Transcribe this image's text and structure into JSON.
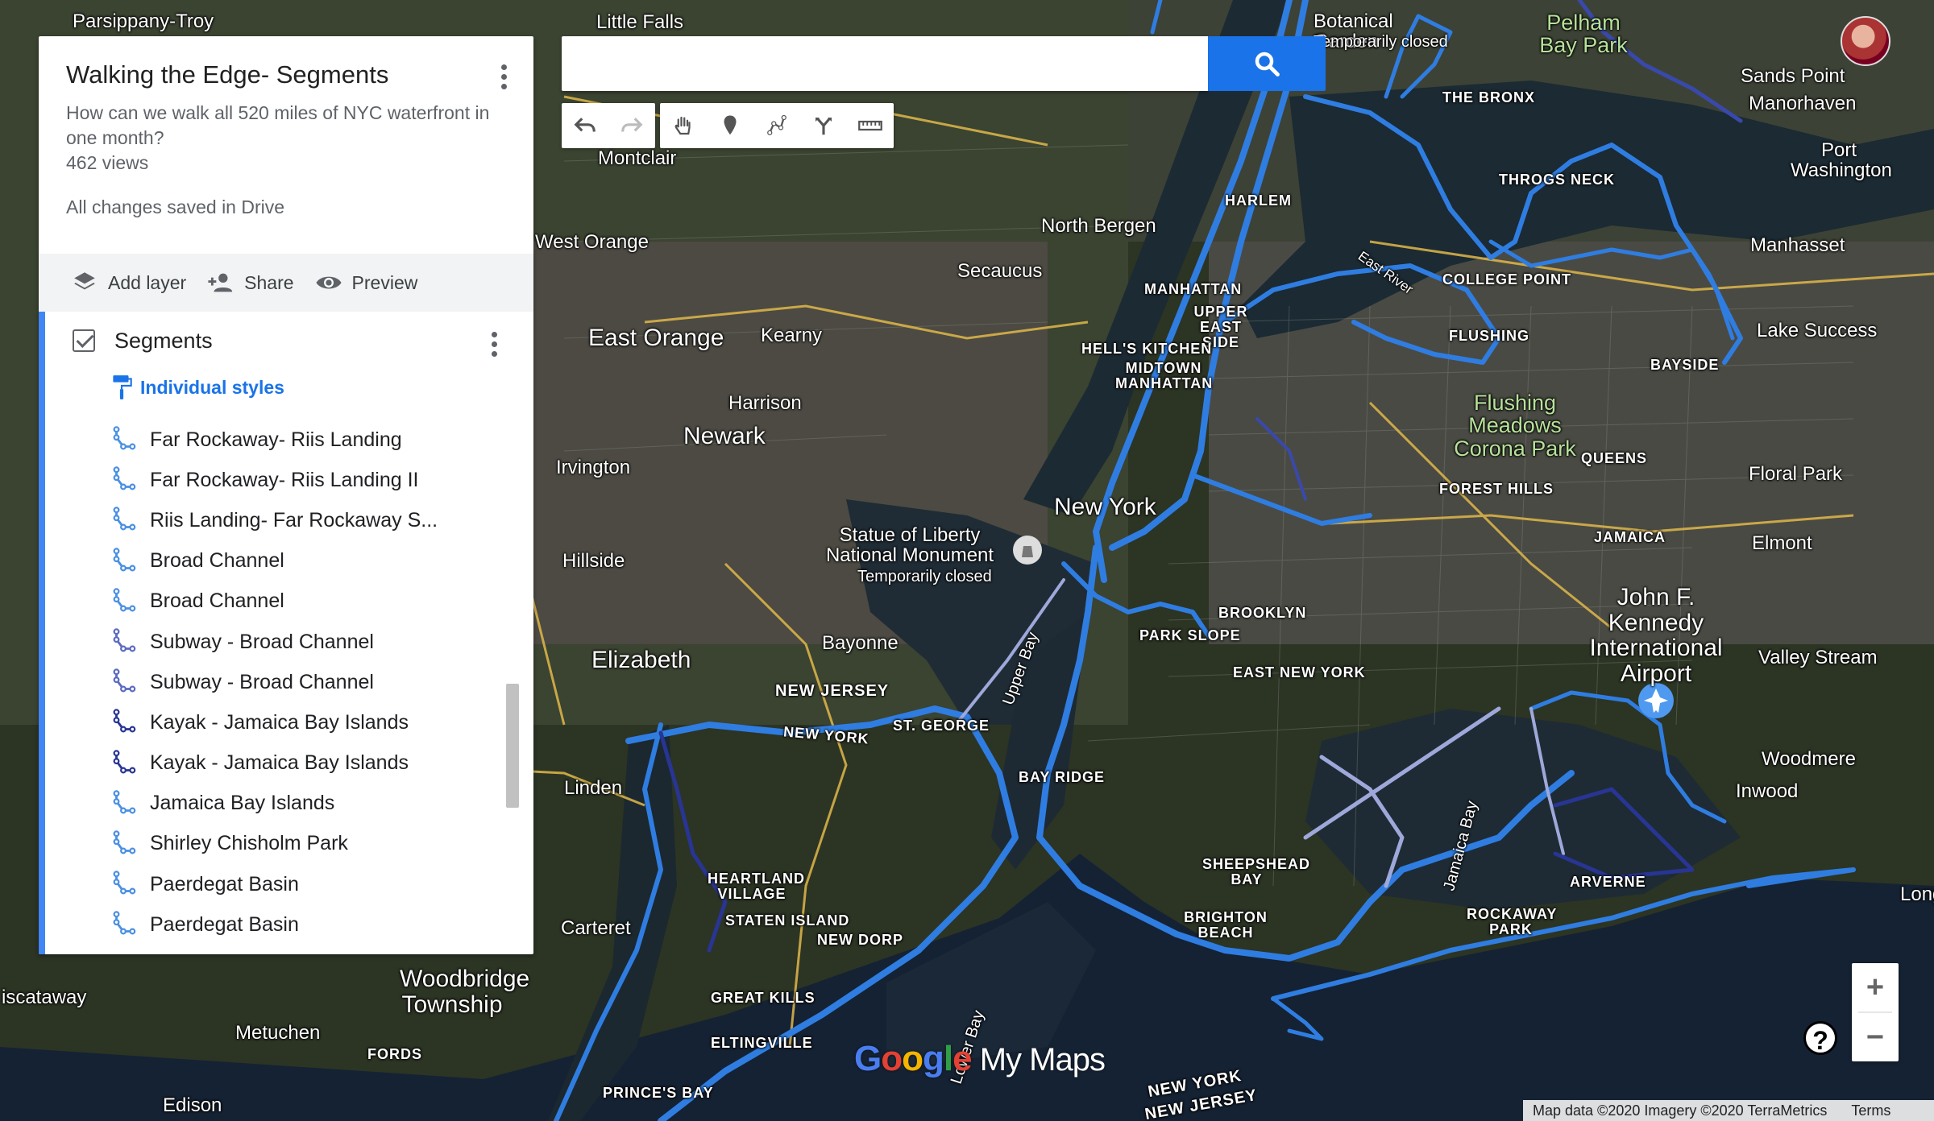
{
  "map_panel": {
    "title": "Walking the Edge- Segments",
    "description": "How can we walk all 520 miles of NYC waterfront in one month?",
    "views": "462 views",
    "save_status": "All changes saved in Drive"
  },
  "toolbar": {
    "add_layer": "Add layer",
    "share": "Share",
    "preview": "Preview"
  },
  "layer": {
    "name": "Segments",
    "checked": true,
    "style_link": "Individual styles",
    "features": [
      {
        "label": "Far Rockaway- Riis Landing",
        "color": "#4a90e2"
      },
      {
        "label": "Far Rockaway- Riis Landing II",
        "color": "#4a90e2"
      },
      {
        "label": "Riis Landing- Far Rockaway S...",
        "color": "#4a90e2"
      },
      {
        "label": "Broad Channel",
        "color": "#4a90e2"
      },
      {
        "label": "Broad Channel",
        "color": "#4a90e2"
      },
      {
        "label": "Subway - Broad Channel",
        "color": "#5c6bc0"
      },
      {
        "label": "Subway - Broad Channel",
        "color": "#5c6bc0"
      },
      {
        "label": "Kayak - Jamaica Bay Islands",
        "color": "#283593"
      },
      {
        "label": "Kayak - Jamaica Bay Islands",
        "color": "#283593"
      },
      {
        "label": "Jamaica Bay Islands",
        "color": "#4a90e2"
      },
      {
        "label": "Shirley Chisholm Park",
        "color": "#4a90e2"
      },
      {
        "label": "Paerdegat Basin",
        "color": "#4a90e2"
      },
      {
        "label": "Paerdegat Basin",
        "color": "#4a90e2"
      }
    ]
  },
  "search": {
    "placeholder": ""
  },
  "map_labels": {
    "parsippany": "Parsippany-Troy",
    "little_falls": "Little Falls",
    "botanical": "Botanical Garden",
    "botanical_status": "Temporarily closed",
    "pelham": "Pelham Bay Park",
    "sands_point": "Sands Point",
    "manorhaven": "Manorhaven",
    "port_washington": "Port Washington",
    "the_bronx": "THE BRONX",
    "throgs_neck": "THROGS NECK",
    "montclair": "Montclair",
    "harlem": "HARLEM",
    "north_bergen": "North Bergen",
    "west_orange": "West Orange",
    "secaucus": "Secaucus",
    "manhasset": "Manhasset",
    "college_point": "COLLEGE POINT",
    "manhattan": "MANHATTAN",
    "upper_east": "UPPER EAST SIDE",
    "east_river": "East River",
    "east_orange": "East Orange",
    "kearny": "Kearny",
    "hells_kitchen": "HELL'S KITCHEN",
    "midtown": "MIDTOWN MANHATTAN",
    "flushing": "FLUSHING",
    "lake_success": "Lake Success",
    "bayside": "BAYSIDE",
    "harrison": "Harrison",
    "newark": "Newark",
    "flushing_meadows": "Flushing Meadows Corona Park",
    "queens": "QUEENS",
    "floral_park": "Floral Park",
    "irvington": "Irvington",
    "new_york": "New York",
    "forest_hills": "FOREST HILLS",
    "statue": "Statue of Liberty National Monument",
    "statue_status": "Temporarily closed",
    "jamaica": "JAMAICA",
    "elmont": "Elmont",
    "hillside": "Hillside",
    "brooklyn": "BROOKLYN",
    "jfk": "John F. Kennedy International Airport",
    "park_slope": "PARK SLOPE",
    "bayonne": "Bayonne",
    "elizabeth": "Elizabeth",
    "east_new_york": "EAST NEW YORK",
    "valley_stream": "Valley Stream",
    "upper_bay": "Upper Bay",
    "new_jersey": "NEW JERSEY",
    "new_york_state": "NEW YORK",
    "st_george": "ST. GEORGE",
    "bay_ridge": "BAY RIDGE",
    "woodmere": "Woodmere",
    "linden": "Linden",
    "inwood": "Inwood",
    "jamaica_bay": "Jamaica Bay",
    "heartland": "HEARTLAND VILLAGE",
    "sheepshead": "SHEEPSHEAD BAY",
    "arverne": "ARVERNE",
    "staten_island": "STATEN ISLAND",
    "carteret": "Carteret",
    "new_dorp": "NEW DORP",
    "rockaway_park": "ROCKAWAY PARK",
    "long_beach": "Long",
    "brighton": "BRIGHTON BEACH",
    "piscataway": "iscataway",
    "woodbridge": "Woodbridge Township",
    "great_kills": "GREAT KILLS",
    "metuchen": "Metuchen",
    "fords": "FORDS",
    "eltingville": "ELTINGVILLE",
    "lower_bay": "Lower Bay",
    "edison": "Edison",
    "princes_bay": "PRINCE'S BAY",
    "ny_nj_1": "NEW YORK",
    "ny_nj_2": "NEW JERSEY"
  },
  "logo": {
    "google": "Google",
    "my_maps": " My Maps"
  },
  "attribution": {
    "text": "Map data ©2020 Imagery ©2020 TerraMetrics",
    "terms": "Terms"
  },
  "zoom": {
    "in": "+",
    "out": "−"
  },
  "help": "?"
}
